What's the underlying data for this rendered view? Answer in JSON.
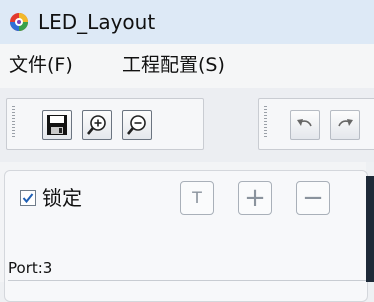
{
  "window": {
    "title": "LED_Layout"
  },
  "menu": {
    "items": [
      {
        "label": "文件(F)"
      },
      {
        "label": "工程配置(S)"
      }
    ]
  },
  "toolbar": {
    "buttons": [
      {
        "icon": "save-icon"
      },
      {
        "icon": "zoom-in-icon"
      },
      {
        "icon": "zoom-out-icon"
      },
      {
        "icon": "undo-icon"
      },
      {
        "icon": "redo-icon"
      }
    ]
  },
  "panel": {
    "lock_checkbox": {
      "label": "锁定",
      "checked": true
    },
    "buttons": [
      {
        "label": "T"
      },
      {
        "label": "+"
      },
      {
        "label": "−"
      }
    ],
    "port_label": "Port:3"
  },
  "colors": {
    "titlebar": "#dde9f6",
    "checkbox_check": "#1f5fb4",
    "dark_edge": "#1e2a38"
  }
}
